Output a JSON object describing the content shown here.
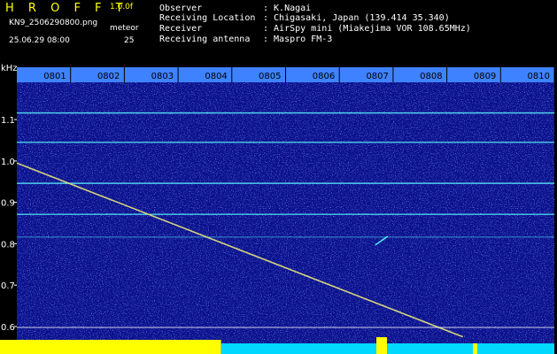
{
  "header": {
    "app_title": "H R O F F T",
    "version": "1.0.0f",
    "filename": "KN9_2506290800.png",
    "meteor_label": "meteor",
    "datetime": "25.06.29 08:00",
    "meteor_count": "25",
    "fields": [
      {
        "label": "Observer",
        "value": ": K.Nagai"
      },
      {
        "label": "Receiving Location",
        "value": ": Chigasaki, Japan (139.414 35.340)"
      },
      {
        "label": "Receiver",
        "value": ": AirSpy mini (Miakejima VOR 108.65MHz)"
      },
      {
        "label": "Receiving antenna",
        "value": ": Maspro FM-3"
      }
    ]
  },
  "colors": {
    "background": "#000000",
    "waterfall": "#0a0f8c",
    "title_yellow": "#ffff00",
    "axis_bar": "#3f82ff",
    "carrier": "#59f0ff",
    "meteor": "#e6e67a",
    "bottom_yellow": "#ffff00",
    "bottom_cyan": "#00d8ff"
  },
  "chart_data": {
    "type": "heatmap",
    "y_unit": "kHz",
    "x_ticks": [
      "0801",
      "0802",
      "0803",
      "0804",
      "0805",
      "0806",
      "0807",
      "0808",
      "0809",
      "0810"
    ],
    "y_ticks": [
      "1.1",
      "1.0",
      "0.9",
      "0.8",
      "0.7",
      "0.6"
    ],
    "ylim": [
      0.57,
      1.19
    ],
    "xlim": [
      0,
      10
    ],
    "carrier_lines_khz": [
      1.116,
      1.045,
      0.946,
      0.871,
      0.816
    ],
    "meteor_trace": [
      {
        "x": 0.0,
        "y": 0.995
      },
      {
        "x": 8.3,
        "y": 0.575
      }
    ],
    "short_echo": [
      {
        "x": 6.67,
        "y": 0.797
      },
      {
        "x": 6.9,
        "y": 0.818
      }
    ],
    "bottom_bar_split_minute": 3.8
  }
}
